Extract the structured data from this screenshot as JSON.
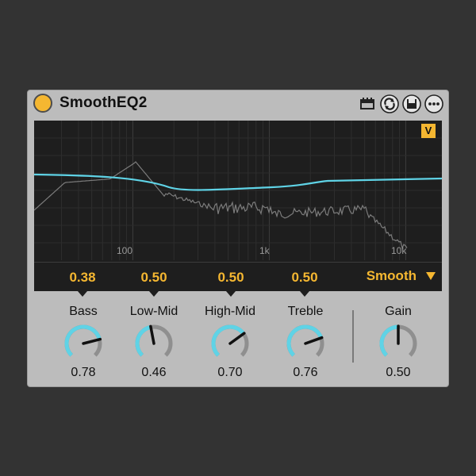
{
  "device": {
    "title": "SmoothEQ2",
    "accent": "#f5b731",
    "curve_color": "#5fd3e6",
    "icons": [
      "power-icon",
      "chain-icon",
      "hot-swap-icon",
      "save-icon",
      "more-icon"
    ]
  },
  "display": {
    "v_button": "V",
    "freq_labels": [
      "100",
      "1k",
      "10k"
    ],
    "band_values": [
      "0.38",
      "0.50",
      "0.50",
      "0.50"
    ],
    "mode": "Smooth"
  },
  "knobs": [
    {
      "label": "Bass",
      "value": "0.78",
      "level": 0.78
    },
    {
      "label": "Low-Mid",
      "value": "0.46",
      "level": 0.46
    },
    {
      "label": "High-Mid",
      "value": "0.70",
      "level": 0.7
    },
    {
      "label": "Treble",
      "value": "0.76",
      "level": 0.76
    },
    {
      "label": "Gain",
      "value": "0.50",
      "level": 0.5
    }
  ]
}
